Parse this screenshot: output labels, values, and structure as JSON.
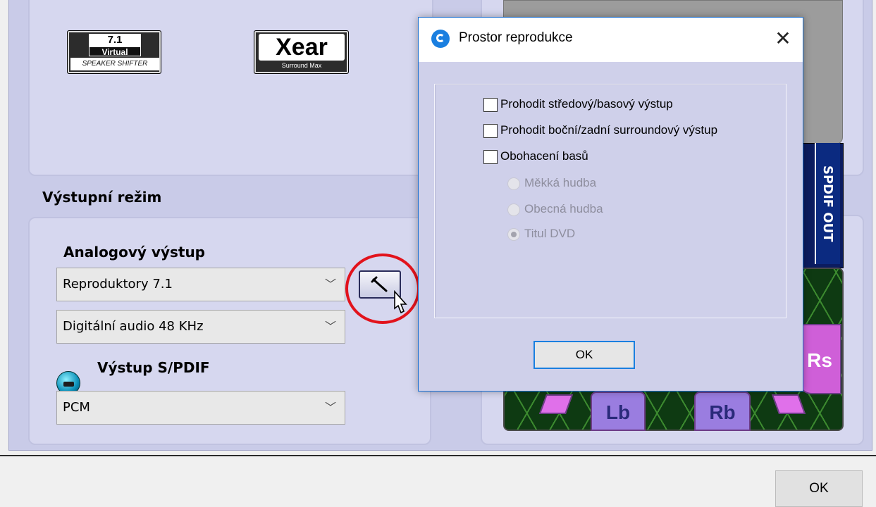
{
  "logos": {
    "virtual_line1": "7.1",
    "virtual_line2": "Virtual",
    "virtual_line3": "SPEAKER SHIFTER",
    "xear_line1": "Xear",
    "xear_line2": "Surround Max"
  },
  "output_section": {
    "title": "Výstupní režim",
    "analog_title": "Analogový výstup",
    "speaker_select_value": "Reproduktory 7.1",
    "digital_select_value": "Digitální audio 48 KHz",
    "spdif_title": "Výstup S/PDIF",
    "spdif_select_value": "PCM",
    "tool_button_icon": "wrench-icon"
  },
  "right_panel": {
    "spdif_out_label": "SPDIF OUT",
    "speakers": [
      "Lb",
      "Rb",
      "Rs"
    ]
  },
  "dialog": {
    "title": "Prostor reprodukce",
    "close_glyph": "✕",
    "checkboxes": [
      {
        "label": "Prohodit středový/basový výstup",
        "checked": false
      },
      {
        "label": "Prohodit boční/zadní surroundový výstup",
        "checked": false
      },
      {
        "label": "Obohacení basů",
        "checked": false
      }
    ],
    "radios": [
      {
        "label": "Měkká hudba",
        "selected": false,
        "enabled": false
      },
      {
        "label": "Obecná hudba",
        "selected": false,
        "enabled": false
      },
      {
        "label": "Titul DVD",
        "selected": true,
        "enabled": false
      }
    ],
    "ok_label": "OK"
  },
  "footer": {
    "ok_label": "OK"
  },
  "colors": {
    "panel_bg": "#c9cbe8",
    "dialog_bg": "#cfd0ea",
    "accent": "#1a7fe0",
    "highlight": "#e2131c"
  }
}
